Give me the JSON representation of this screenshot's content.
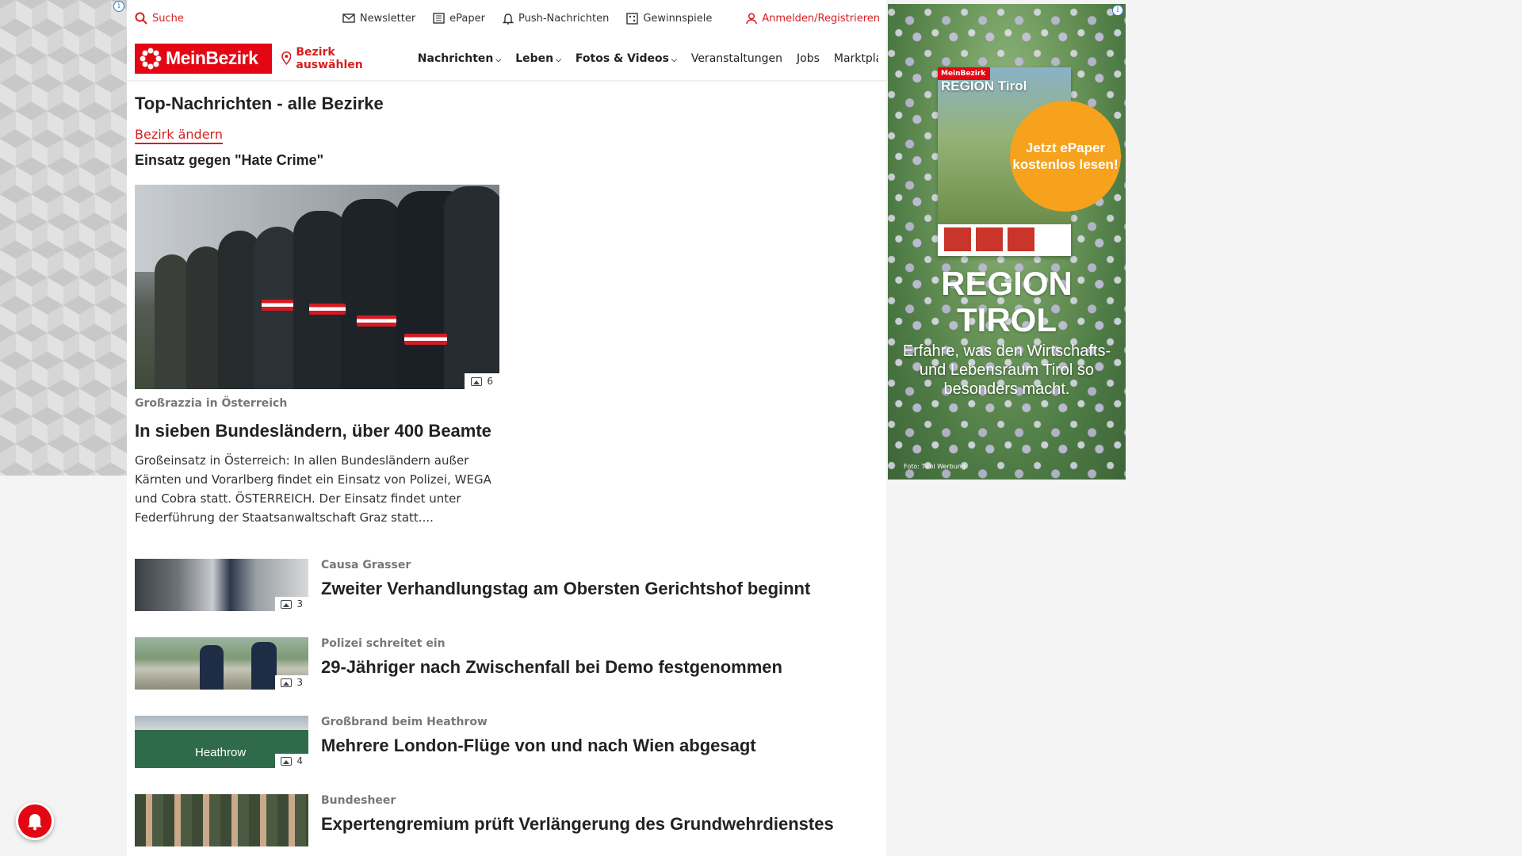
{
  "topbar": {
    "search": "Suche",
    "newsletter": "Newsletter",
    "epaper": "ePaper",
    "push": "Push-Nachrichten",
    "gewinnspiele": "Gewinnspiele",
    "login": "Anmelden/Registrieren"
  },
  "nav": {
    "logo": "MeinBezirk",
    "region": "Bezirk auswählen",
    "items": [
      "Nachrichten",
      "Leben",
      "Fotos & Videos",
      "Veranstaltungen",
      "Jobs",
      "Marktplatz"
    ]
  },
  "main": {
    "section_title": "Top-Nachrichten - alle Bezirke",
    "change_link": "Bezirk ändern",
    "hashtag": "Einsatz gegen \"Hate Crime\"",
    "hero": {
      "image_count": "6",
      "kicker": "Großrazzia in Österreich",
      "title": "In sieben Bundesländern, über 400 Beamte",
      "text": "Großeinsatz in Österreich: In allen Bundesländern außer Kärnten und Vorarlberg findet ein Einsatz von Polizei, WEGA und Cobra statt. ÖSTERREICH. Der Einsatz findet unter Federführung der Staatsanwaltschaft Graz statt...."
    },
    "articles": [
      {
        "kicker": "Causa Grasser",
        "title": "Zweiter Verhandlungstag am Obersten Gerichtshof beginnt",
        "image_count": "3"
      },
      {
        "kicker": "Polizei schreitet ein",
        "title": "29-Jähriger nach Zwischenfall bei Demo festgenommen",
        "image_count": "3"
      },
      {
        "kicker": "Großbrand beim Heathrow",
        "title": "Mehrere London-Flüge von und nach Wien abgesagt",
        "image_count": "4",
        "sign_text": "Heathrow"
      },
      {
        "kicker": "Bundesheer",
        "title": "Expertengremium prüft Verlängerung des Grundwehrdienstes"
      }
    ]
  },
  "ad": {
    "mag_header": "MeinBezirk",
    "mag_title": "REGION Tirol",
    "badge": "Jetzt ePaper kostenlos lesen!",
    "brand_line1": "REGION",
    "brand_line2": "TIROL",
    "tagline": "Erfahre, was den Wirtschafts- und Lebensraum Tirol so besonders macht.",
    "credit": "Foto: Tirol Werbung"
  },
  "colors": {
    "brand_red": "#e30613",
    "accent_orange": "#f6a21c"
  }
}
